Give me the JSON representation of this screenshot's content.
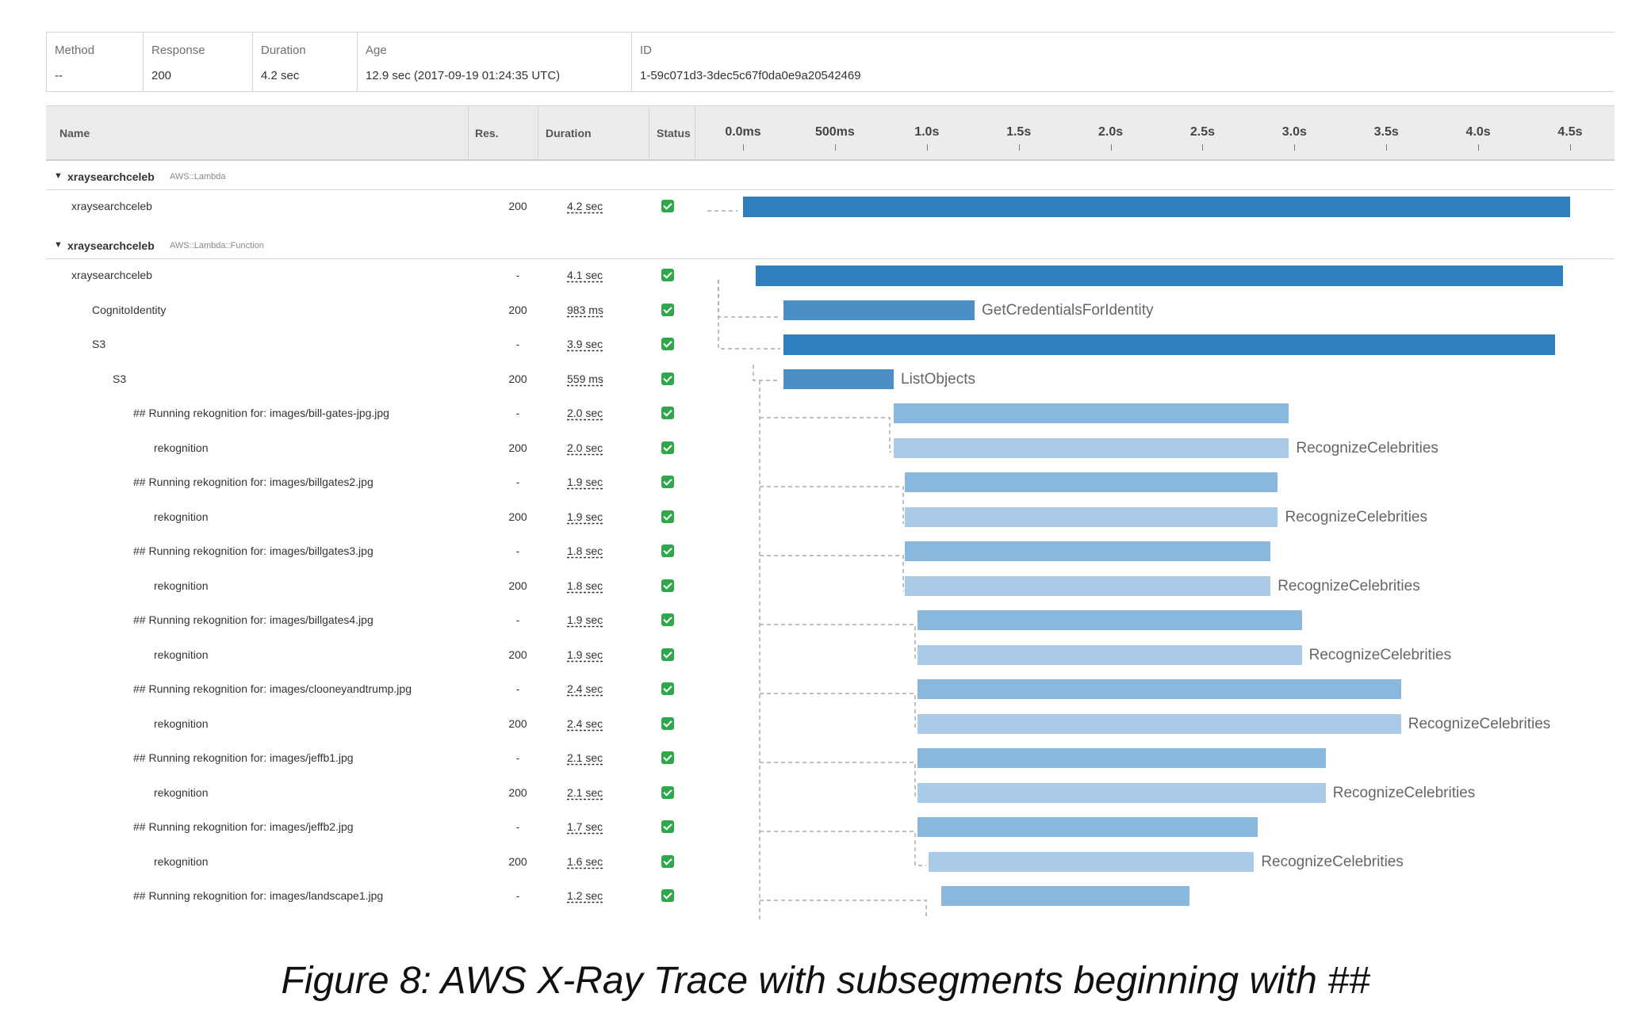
{
  "summary": {
    "method_label": "Method",
    "method_value": "--",
    "response_label": "Response",
    "response_value": "200",
    "duration_label": "Duration",
    "duration_value": "4.2 sec",
    "age_label": "Age",
    "age_value": "12.9 sec (2017-09-19 01:24:35 UTC)",
    "id_label": "ID",
    "id_value": "1-59c071d3-3dec5c67f0da0e9a20542469"
  },
  "headers": {
    "name": "Name",
    "res": "Res.",
    "duration": "Duration",
    "status": "Status"
  },
  "timeline": {
    "max_seconds": 4.5,
    "ticks": [
      {
        "label": "0.0ms",
        "t": 0.0
      },
      {
        "label": "500ms",
        "t": 0.5
      },
      {
        "label": "1.0s",
        "t": 1.0
      },
      {
        "label": "1.5s",
        "t": 1.5
      },
      {
        "label": "2.0s",
        "t": 2.0
      },
      {
        "label": "2.5s",
        "t": 2.5
      },
      {
        "label": "3.0s",
        "t": 3.0
      },
      {
        "label": "3.5s",
        "t": 3.5
      },
      {
        "label": "4.0s",
        "t": 4.0
      },
      {
        "label": "4.5s",
        "t": 4.5
      }
    ]
  },
  "groups": [
    {
      "name": "xraysearchceleb",
      "type": "AWS::Lambda"
    },
    {
      "name": "xraysearchceleb",
      "type": "AWS::Lambda::Function"
    }
  ],
  "rows": [
    {
      "group": 0,
      "indent": 0,
      "name": "xraysearchceleb",
      "res": "200",
      "duration": "4.2 sec",
      "start": 0.0,
      "end": 4.5,
      "shade": "dark",
      "bar_label": ""
    },
    {
      "group": 1,
      "indent": 0,
      "name": "xraysearchceleb",
      "res": "-",
      "duration": "4.1 sec",
      "start": 0.07,
      "end": 4.46,
      "shade": "dark",
      "bar_label": ""
    },
    {
      "group": 1,
      "indent": 1,
      "name": "CognitoIdentity",
      "res": "200",
      "duration": "983 ms",
      "start": 0.22,
      "end": 1.26,
      "shade": "mid",
      "bar_label": "GetCredentialsForIdentity"
    },
    {
      "group": 1,
      "indent": 1,
      "name": "S3",
      "res": "-",
      "duration": "3.9 sec",
      "start": 0.22,
      "end": 4.42,
      "shade": "dark",
      "bar_label": ""
    },
    {
      "group": 1,
      "indent": 2,
      "name": "S3",
      "res": "200",
      "duration": "559 ms",
      "start": 0.22,
      "end": 0.82,
      "shade": "mid",
      "bar_label": "ListObjects"
    },
    {
      "group": 1,
      "indent": 3,
      "name": "## Running rekognition for: images/bill-gates-jpg.jpg",
      "res": "-",
      "duration": "2.0 sec",
      "start": 0.82,
      "end": 2.97,
      "shade": "light",
      "bar_label": ""
    },
    {
      "group": 1,
      "indent": 4,
      "name": "rekognition",
      "res": "200",
      "duration": "2.0 sec",
      "start": 0.82,
      "end": 2.97,
      "shade": "pale",
      "bar_label": "RecognizeCelebrities"
    },
    {
      "group": 1,
      "indent": 3,
      "name": "## Running rekognition for: images/billgates2.jpg",
      "res": "-",
      "duration": "1.9 sec",
      "start": 0.88,
      "end": 2.91,
      "shade": "light",
      "bar_label": ""
    },
    {
      "group": 1,
      "indent": 4,
      "name": "rekognition",
      "res": "200",
      "duration": "1.9 sec",
      "start": 0.88,
      "end": 2.91,
      "shade": "pale",
      "bar_label": "RecognizeCelebrities"
    },
    {
      "group": 1,
      "indent": 3,
      "name": "## Running rekognition for: images/billgates3.jpg",
      "res": "-",
      "duration": "1.8 sec",
      "start": 0.88,
      "end": 2.87,
      "shade": "light",
      "bar_label": ""
    },
    {
      "group": 1,
      "indent": 4,
      "name": "rekognition",
      "res": "200",
      "duration": "1.8 sec",
      "start": 0.88,
      "end": 2.87,
      "shade": "pale",
      "bar_label": "RecognizeCelebrities"
    },
    {
      "group": 1,
      "indent": 3,
      "name": "## Running rekognition for: images/billgates4.jpg",
      "res": "-",
      "duration": "1.9 sec",
      "start": 0.95,
      "end": 3.04,
      "shade": "light",
      "bar_label": ""
    },
    {
      "group": 1,
      "indent": 4,
      "name": "rekognition",
      "res": "200",
      "duration": "1.9 sec",
      "start": 0.95,
      "end": 3.04,
      "shade": "pale",
      "bar_label": "RecognizeCelebrities"
    },
    {
      "group": 1,
      "indent": 3,
      "name": "## Running rekognition for: images/clooneyandtrump.jpg",
      "res": "-",
      "duration": "2.4 sec",
      "start": 0.95,
      "end": 3.58,
      "shade": "light",
      "bar_label": ""
    },
    {
      "group": 1,
      "indent": 4,
      "name": "rekognition",
      "res": "200",
      "duration": "2.4 sec",
      "start": 0.95,
      "end": 3.58,
      "shade": "pale",
      "bar_label": "RecognizeCelebrities"
    },
    {
      "group": 1,
      "indent": 3,
      "name": "## Running rekognition for: images/jeffb1.jpg",
      "res": "-",
      "duration": "2.1 sec",
      "start": 0.95,
      "end": 3.17,
      "shade": "light",
      "bar_label": ""
    },
    {
      "group": 1,
      "indent": 4,
      "name": "rekognition",
      "res": "200",
      "duration": "2.1 sec",
      "start": 0.95,
      "end": 3.17,
      "shade": "pale",
      "bar_label": "RecognizeCelebrities"
    },
    {
      "group": 1,
      "indent": 3,
      "name": "## Running rekognition for: images/jeffb2.jpg",
      "res": "-",
      "duration": "1.7 sec",
      "start": 0.95,
      "end": 2.8,
      "shade": "light",
      "bar_label": ""
    },
    {
      "group": 1,
      "indent": 4,
      "name": "rekognition",
      "res": "200",
      "duration": "1.6 sec",
      "start": 1.01,
      "end": 2.78,
      "shade": "pale",
      "bar_label": "RecognizeCelebrities"
    },
    {
      "group": 1,
      "indent": 3,
      "name": "## Running rekognition for: images/landscape1.jpg",
      "res": "-",
      "duration": "1.2 sec",
      "start": 1.08,
      "end": 2.43,
      "shade": "light",
      "bar_label": ""
    }
  ],
  "colors": {
    "dark": "#2e7fbc",
    "mid": "#4a8fc6",
    "light": "#8ab8dd",
    "pale": "#a9cbe7",
    "status_ok": "#2ea84a"
  },
  "caption": "Figure 8: AWS X-Ray Trace with subsegments beginning with ##"
}
